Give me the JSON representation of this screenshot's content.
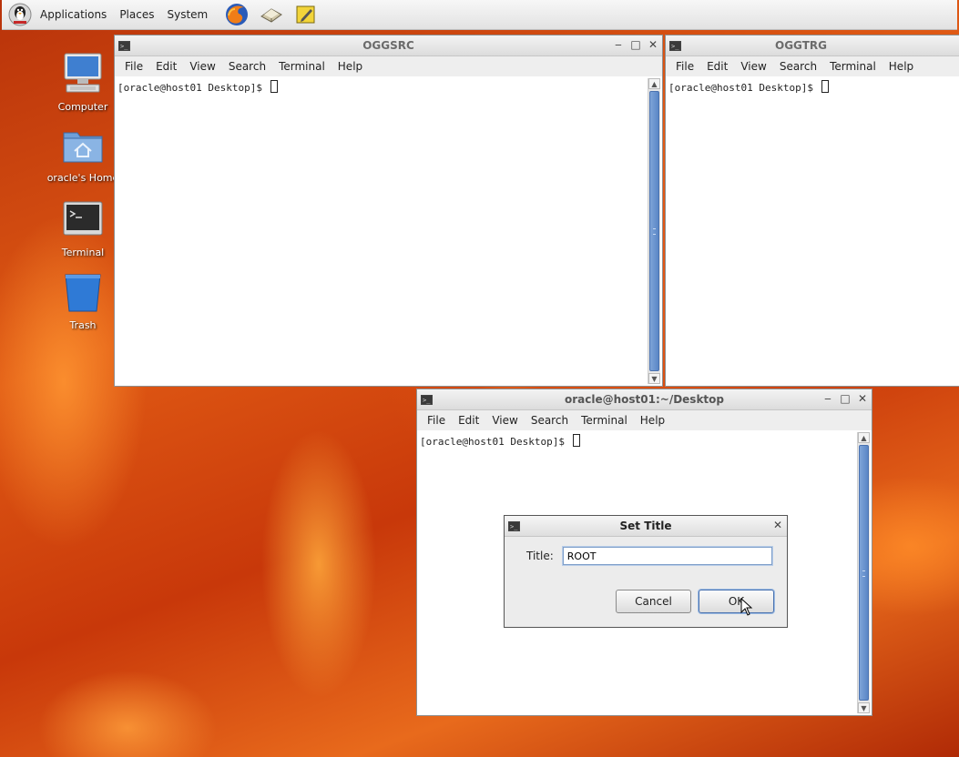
{
  "panel": {
    "menus": [
      "Applications",
      "Places",
      "System"
    ]
  },
  "desktop_icons": [
    {
      "label": "Computer",
      "icon": "computer-icon"
    },
    {
      "label": "oracle's Home",
      "icon": "home-folder-icon"
    },
    {
      "label": "Terminal",
      "icon": "terminal-icon"
    },
    {
      "label": "Trash",
      "icon": "trash-icon"
    }
  ],
  "menu_items": [
    "File",
    "Edit",
    "View",
    "Search",
    "Terminal",
    "Help"
  ],
  "windows": {
    "oggsrc": {
      "title": "OGGSRC",
      "prompt": "[oracle@host01 Desktop]$ "
    },
    "oggtrg": {
      "title": "OGGTRG",
      "prompt": "[oracle@host01 Desktop]$ "
    },
    "desktop": {
      "title": "oracle@host01:~/Desktop",
      "prompt": "[oracle@host01 Desktop]$ "
    }
  },
  "dialog": {
    "title": "Set Title",
    "field_label": "Title:",
    "field_value": "ROOT",
    "cancel_label": "Cancel",
    "ok_label": "OK"
  },
  "colors": {
    "scroll_thumb": "#6a93cf",
    "panel_bg": "#ececec"
  }
}
